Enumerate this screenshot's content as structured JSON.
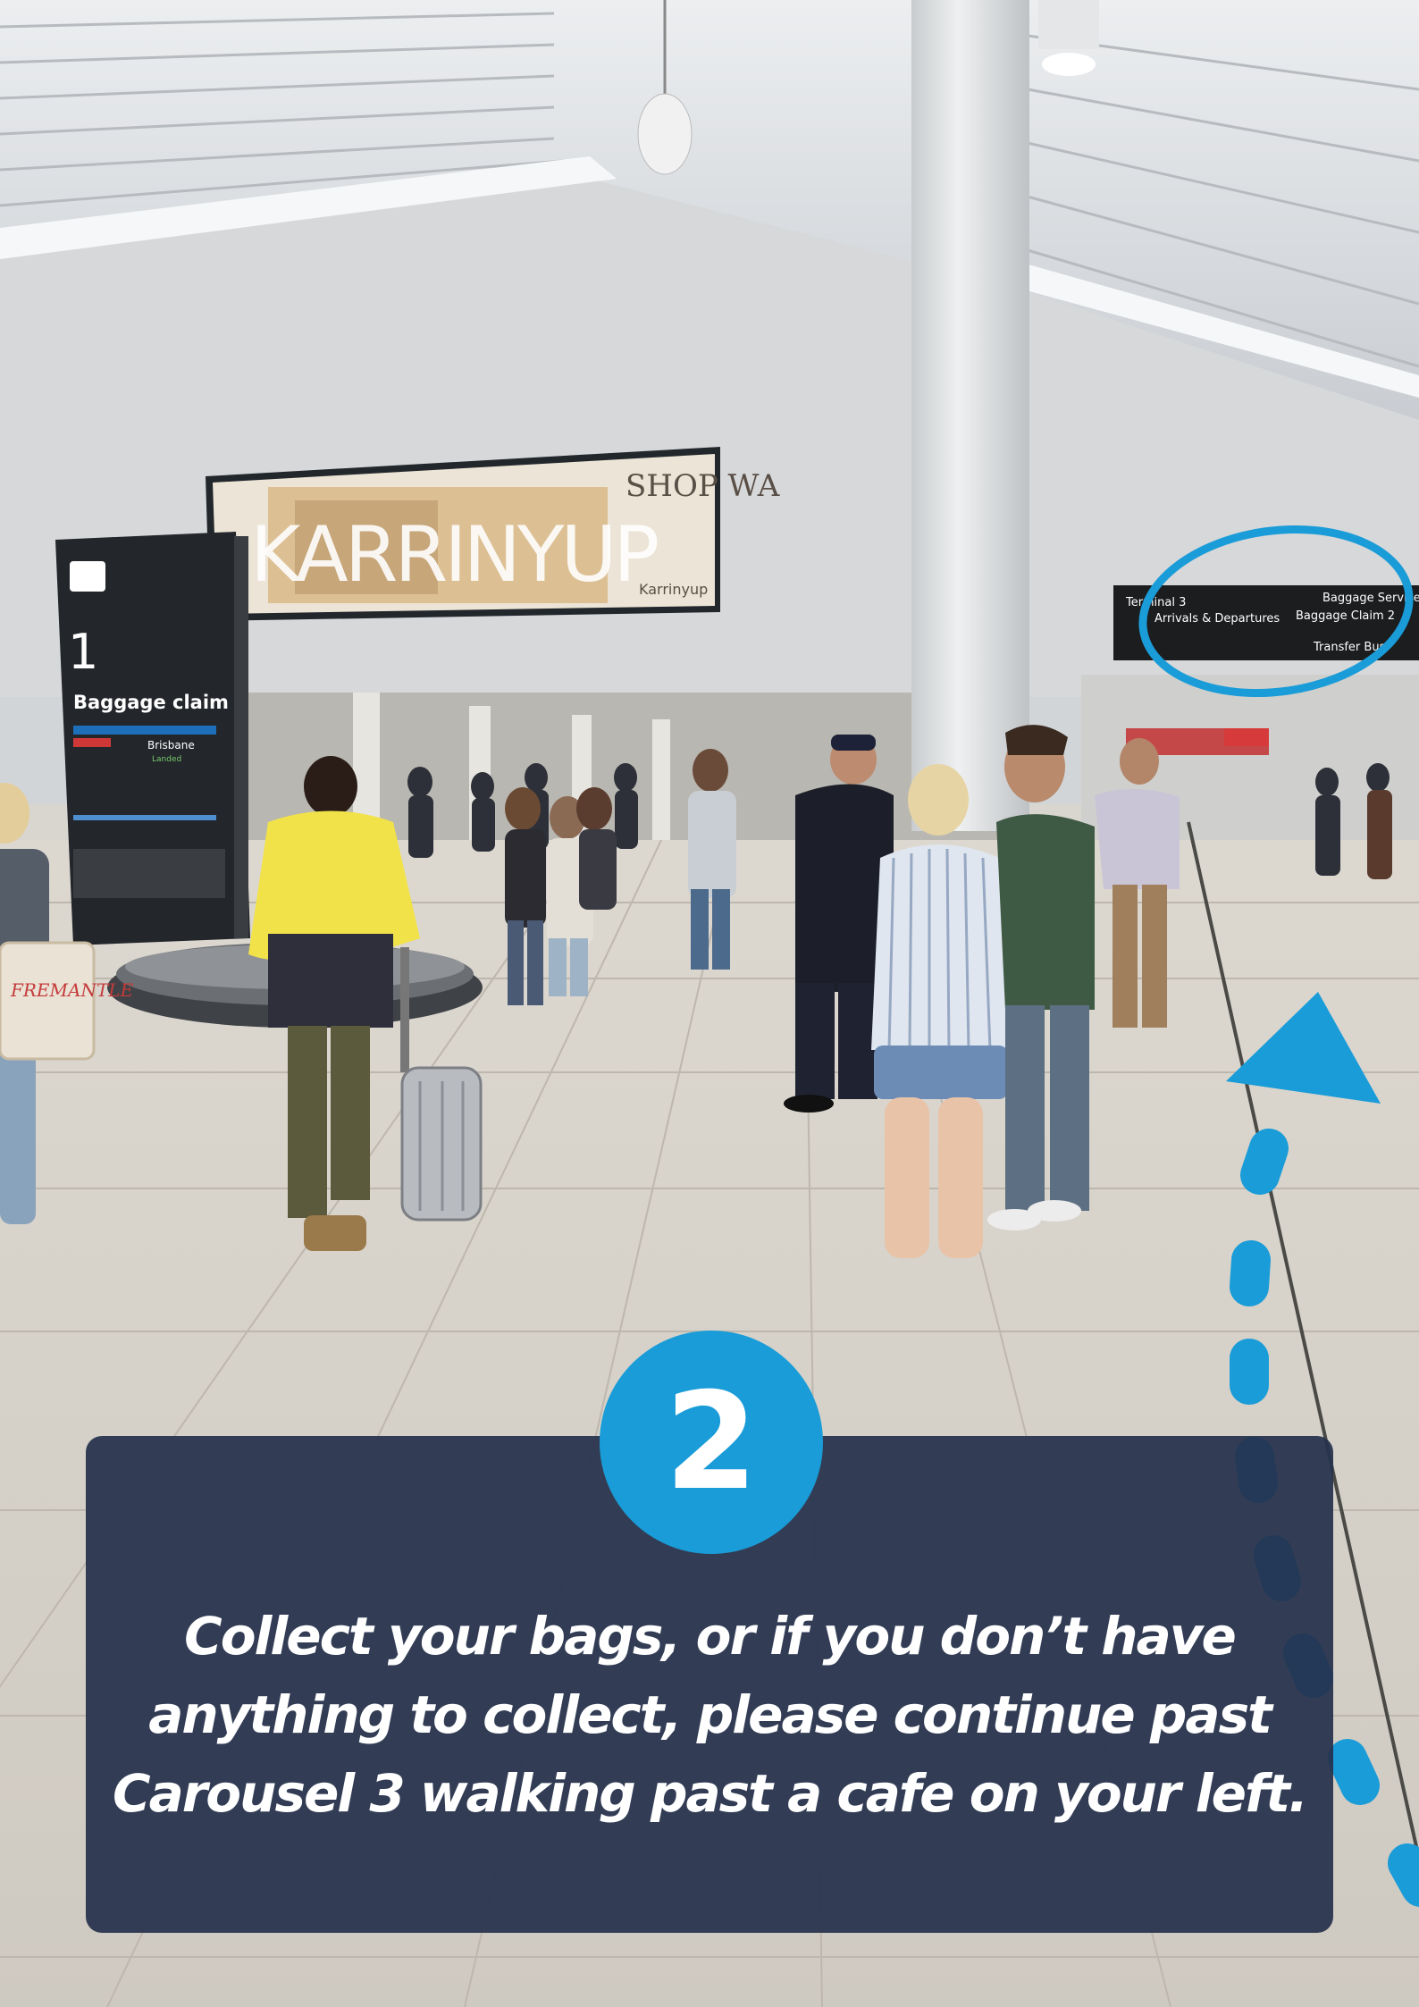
{
  "photo": {
    "billboard": {
      "brand": "KARRINYUP",
      "tagline": "SHOP WA",
      "logo_text": "Karrinyup"
    },
    "pillar_sign": {
      "number": "1",
      "title": "Baggage claim",
      "flight_city": "Brisbane",
      "flight_status": "Landed"
    },
    "overhead_sign": {
      "left_rows": [
        "Terminal 3",
        "Arrivals & Departures"
      ],
      "right_rows": [
        "Baggage Services",
        "Baggage Claim 2",
        "Transfer Bus"
      ]
    },
    "bag_text": "FREMANTLE"
  },
  "step": {
    "number": "2",
    "instruction_lines": [
      "Collect your bags, or if you don’t have",
      "anything to collect, please continue past",
      "Carousel 3 walking past a cafe on your left."
    ]
  },
  "colors": {
    "accent_blue": "#1a9cd8",
    "panel_navy": "#26324c"
  }
}
